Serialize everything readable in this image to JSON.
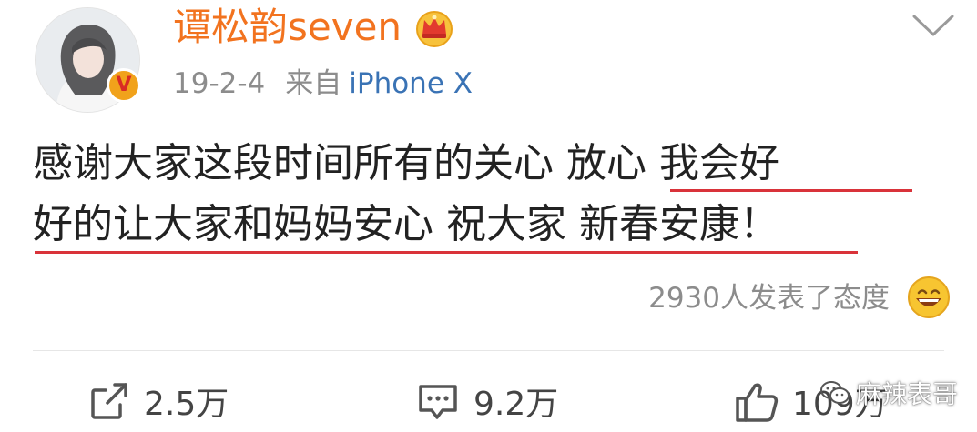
{
  "header": {
    "username": "谭松韵seven",
    "date": "19-2-4",
    "source_prefix": "来自",
    "device": "iPhone X",
    "verified_badge": "V",
    "icons": {
      "crown": "crown-icon",
      "chevron": "chevron-down-icon"
    }
  },
  "post": {
    "line1_plain": "感谢大家这段时间所有的关心 ",
    "line1_highlight": "放心 我会好",
    "line2": "好的让大家和妈妈安心 祝大家 新春安康！"
  },
  "reactions": {
    "text": "2930人发表了态度",
    "icon": "grinning-emoji-icon"
  },
  "actions": {
    "repost": {
      "icon": "share-icon",
      "count": "2.5万"
    },
    "comment": {
      "icon": "comment-icon",
      "count": "9.2万"
    },
    "like": {
      "icon": "thumbs-up-icon",
      "count": "109万"
    }
  },
  "watermark": {
    "text": "麻辣表哥",
    "icon": "wechat-icon"
  },
  "colors": {
    "username": "#f2731f",
    "device_link": "#3a73b5",
    "meta_gray": "#8c8c8c",
    "underline": "#d9333a",
    "badge": "#f1a21b"
  }
}
